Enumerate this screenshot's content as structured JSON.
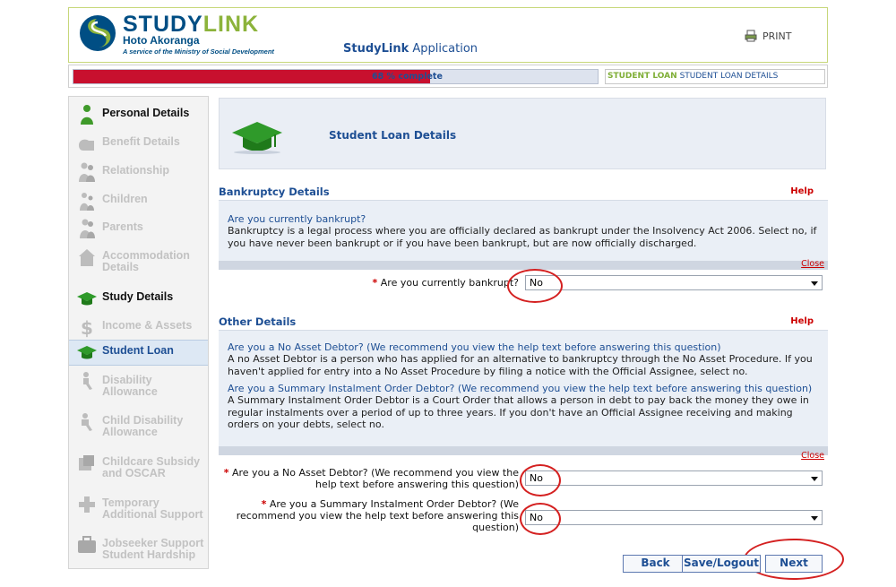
{
  "header": {
    "logo_part1": "STUDY",
    "logo_part2": "LINK",
    "logo_subtitle": "Hoto Akoranga",
    "logo_tagline": "A service of the Ministry of Social Development",
    "app_title_bold": "StudyLink",
    "app_title_rest": "Application",
    "print_label": "PRINT"
  },
  "progress": {
    "percent": 68,
    "label": "68 % complete",
    "breadcrumb_section": "STUDENT LOAN",
    "breadcrumb_page": "STUDENT LOAN DETAILS"
  },
  "sidebar": {
    "items": [
      {
        "label": "Personal Details",
        "state": "done",
        "icon": "person-icon"
      },
      {
        "label": "Benefit Details",
        "state": "disabled",
        "icon": "hand-icon"
      },
      {
        "label": "Relationship",
        "state": "disabled",
        "icon": "couple-icon"
      },
      {
        "label": "Children",
        "state": "disabled",
        "icon": "children-icon"
      },
      {
        "label": "Parents",
        "state": "disabled",
        "icon": "parents-icon"
      },
      {
        "label": "Accommodation Details",
        "state": "disabled",
        "icon": "house-icon"
      },
      {
        "label": "Study Details",
        "state": "done",
        "icon": "graduation-cap-icon"
      },
      {
        "label": "Income & Assets",
        "state": "disabled",
        "icon": "dollar-icon"
      },
      {
        "label": "Student Loan",
        "state": "active",
        "icon": "graduation-cap-icon"
      },
      {
        "label": "Disability Allowance",
        "state": "disabled",
        "icon": "disability-icon"
      },
      {
        "label": "Child Disability Allowance",
        "state": "disabled",
        "icon": "child-disability-icon"
      },
      {
        "label": "Childcare Subsidy and OSCAR",
        "state": "disabled",
        "icon": "blocks-icon"
      },
      {
        "label": "Temporary Additional Support",
        "state": "disabled",
        "icon": "plus-icon"
      },
      {
        "label": "Jobseeker Support Student Hardship",
        "state": "disabled",
        "icon": "briefcase-icon"
      }
    ]
  },
  "main": {
    "section_title": "Student Loan Details",
    "bankruptcy": {
      "heading": "Bankruptcy Details",
      "help_label": "Help",
      "help_question": "Are you currently bankrupt?",
      "help_answer": "Bankruptcy is a legal process where you are officially declared as bankrupt under the Insolvency Act 2006. Select no, if you have never been bankrupt or if you have been bankrupt, but are now officially discharged.",
      "close_label": "Close",
      "field_label": "Are you currently bankrupt?",
      "field_value": "No"
    },
    "other": {
      "heading": "Other Details",
      "help_label": "Help",
      "help_q1": "Are you a No Asset Debtor? (We recommend you view the help text before answering this question)",
      "help_a1": "A no Asset Debtor is a person who has applied for an alternative to bankruptcy through the No Asset Procedure. If you haven't applied for entry into a No Asset Procedure by filing a notice with the Official Assignee, select no.",
      "help_q2": "Are you a Summary Instalment Order Debtor? (We recommend you view the help text before answering this question)",
      "help_a2": "A Summary Instalment Order Debtor is a Court Order that allows a person in debt to pay back the money they owe in regular instalments over a period of up to three years. If you don't have an Official Assignee receiving and making orders on your debts, select no.",
      "close_label": "Close",
      "field1_label": "Are you a No Asset Debtor? (We recommend you view the help text before answering this question)",
      "field1_value": "No",
      "field2_label": "Are you a Summary Instalment Order Debtor? (We recommend you view the help text before answering this question)",
      "field2_value": "No"
    }
  },
  "buttons": {
    "back": "Back",
    "save": "Save/Logout",
    "next": "Next"
  },
  "colors": {
    "brand_blue": "#1e4f94",
    "brand_green": "#8cb33b",
    "progress_red": "#c8102e",
    "annotation_red": "#d42020"
  }
}
